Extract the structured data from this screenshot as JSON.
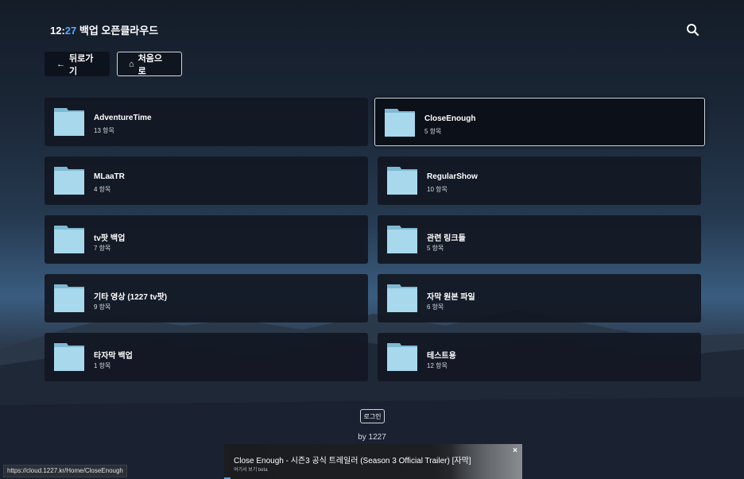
{
  "header": {
    "time_hour": "12:",
    "time_minute": "27",
    "title": " 백업 오픈클라우드"
  },
  "nav": {
    "back_label": "뒤로가기",
    "home_label": "처음으로",
    "back_icon": "←",
    "home_icon": "⌂"
  },
  "folders": [
    {
      "name": "AdventureTime",
      "count": "13 항목"
    },
    {
      "name": "CloseEnough",
      "count": "5 항목",
      "selected": true
    },
    {
      "name": "MLaaTR",
      "count": "4 항목"
    },
    {
      "name": "RegularShow",
      "count": "10 항목"
    },
    {
      "name": "tv팟 백업",
      "count": "7 항목"
    },
    {
      "name": "관련 링크들",
      "count": "5 항목"
    },
    {
      "name": "기타 영상 (1227 tv팟)",
      "count": "9 항목"
    },
    {
      "name": "자막 원본 파일",
      "count": "6 항목"
    },
    {
      "name": "타자막 백업",
      "count": "1 항목"
    },
    {
      "name": "테스트용",
      "count": "12 항목"
    }
  ],
  "footer": {
    "login_label": "로그인",
    "byline": "by 1227"
  },
  "status_bar": {
    "url": "https://cloud.1227.kr/Home/CloseEnough"
  },
  "video_popup": {
    "title": "Close Enough - 시즌3 공식 트레일러 (Season 3 Official Trailer) [자막]",
    "subtitle": "여기서 보기 beta",
    "close": "×"
  },
  "colors": {
    "accent": "#5aa8ff",
    "folder": "#a8d8ec",
    "card_bg": "#121822"
  }
}
